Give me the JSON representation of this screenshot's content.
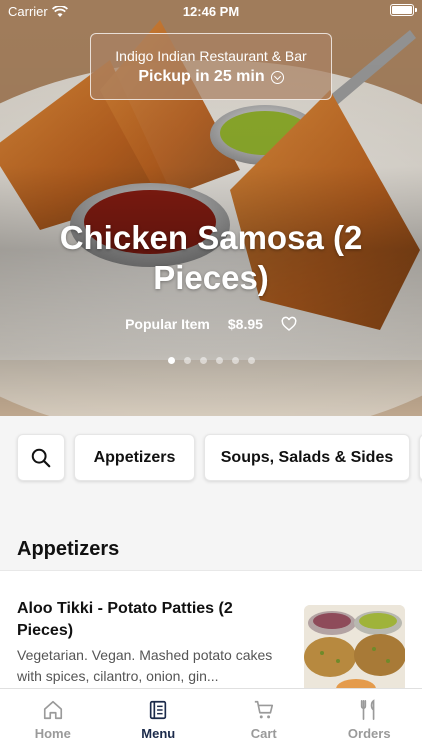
{
  "status_bar": {
    "carrier": "Carrier",
    "time": "12:46 PM"
  },
  "pickup_banner": {
    "restaurant": "Indigo Indian Restaurant & Bar",
    "pickup_text": "Pickup in 25 min"
  },
  "hero": {
    "title": "Chicken Samosa (2 Pieces)",
    "badge": "Popular Item",
    "price": "$8.95",
    "carousel_count": 6,
    "carousel_active": 0
  },
  "categories": [
    "Appetizers",
    "Soups, Salads & Sides"
  ],
  "section": {
    "title": "Appetizers",
    "items": [
      {
        "name": "Aloo Tikki - Potato Patties (2 Pieces)",
        "description": "Vegetarian. Vegan. Mashed potato cakes with spices, cilantro, onion, gin..."
      }
    ]
  },
  "tabbar": {
    "home": "Home",
    "menu": "Menu",
    "cart": "Cart",
    "orders": "Orders",
    "active": "Menu"
  },
  "colors": {
    "active_tab": "#1b2a4a",
    "inactive_tab": "#9a9a9a",
    "background": "#f5f5f5"
  },
  "icons": [
    "wifi-icon",
    "battery-icon",
    "chevron-down-circle-icon",
    "heart-icon",
    "search-icon",
    "home-icon",
    "menu-book-icon",
    "cart-icon",
    "utensils-icon"
  ]
}
